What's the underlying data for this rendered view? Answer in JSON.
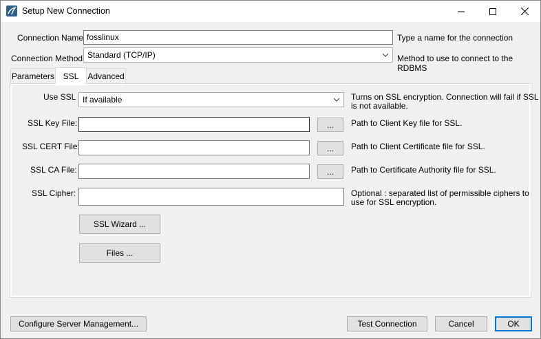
{
  "window": {
    "title": "Setup New Connection"
  },
  "form": {
    "connection_name_label": "Connection Name:",
    "connection_name_value": "fosslinux",
    "connection_name_hint": "Type a name for the connection",
    "connection_method_label": "Connection Method:",
    "connection_method_value": "Standard (TCP/IP)",
    "connection_method_hint": "Method to use to connect to the RDBMS"
  },
  "tabs": [
    {
      "label": "Parameters",
      "active": false
    },
    {
      "label": "SSL",
      "active": true
    },
    {
      "label": "Advanced",
      "active": false
    }
  ],
  "ssl": {
    "use_ssl_label": "Use SSL",
    "use_ssl_value": "If available",
    "use_ssl_hint_line1": "Turns on SSL encryption. Connection will fail if SSL",
    "use_ssl_hint_line2": "is not available.",
    "key_file_label": "SSL Key File:",
    "key_file_value": "",
    "key_file_hint": "Path to Client Key file for SSL.",
    "cert_file_label": "SSL CERT File:",
    "cert_file_value": "",
    "cert_file_hint": "Path to Client Certificate file for SSL.",
    "ca_file_label": "SSL CA File:",
    "ca_file_value": "",
    "ca_file_hint": "Path to Certificate Authority file for SSL.",
    "cipher_label": "SSL Cipher:",
    "cipher_value": "",
    "cipher_hint_line1": "Optional : separated list of permissible ciphers to",
    "cipher_hint_line2": "use for SSL encryption.",
    "browse_label": "...",
    "wizard_label": "SSL Wizard ...",
    "files_label": "Files ..."
  },
  "footer": {
    "configure_label": "Configure Server Management...",
    "test_label": "Test Connection",
    "cancel_label": "Cancel",
    "ok_label": "OK"
  },
  "colors": {
    "accent": "#0078d7",
    "button_face": "#e1e1e1",
    "window_bg": "#f0f0f0"
  },
  "icons": {
    "app": "mysql-workbench-icon",
    "minimize": "minimize-icon",
    "maximize": "maximize-icon",
    "close": "close-icon",
    "dropdown": "chevron-down-icon"
  }
}
